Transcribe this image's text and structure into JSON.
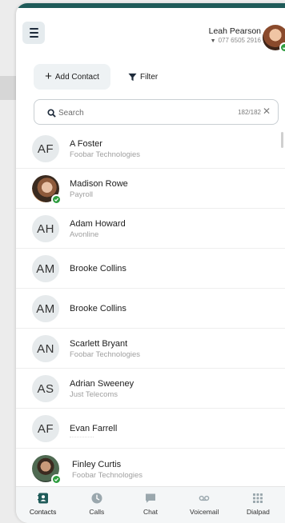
{
  "header": {
    "user_name": "Leah Pearson",
    "user_phone": "077 6505 2916",
    "status_color": "#2e9d3f"
  },
  "toolbar": {
    "add_contact_label": "Add Contact",
    "filter_label": "Filter"
  },
  "search": {
    "placeholder": "Search",
    "count": "182/182"
  },
  "contacts": [
    {
      "initials": "AF",
      "name": "A Foster",
      "company": "Foobar Technologies"
    },
    {
      "initials": "",
      "name": "Madison Rowe",
      "company": "Payroll",
      "online": true
    },
    {
      "initials": "AH",
      "name": "Adam Howard",
      "company": "Avonline"
    },
    {
      "initials": "AM",
      "name": "Brooke Collins",
      "company": ""
    },
    {
      "initials": "AM",
      "name": "Brooke Collins",
      "company": ""
    },
    {
      "initials": "AN",
      "name": "Scarlett Bryant",
      "company": "Foobar Technologies"
    },
    {
      "initials": "AS",
      "name": "Adrian Sweeney",
      "company": "Just Telecoms"
    },
    {
      "initials": "AF",
      "name": "Evan Farrell",
      "company": ""
    },
    {
      "initials": "",
      "name": "Finley Curtis",
      "company": "Foobar Technologies",
      "online": true
    }
  ],
  "nav": {
    "items": [
      {
        "label": "Contacts",
        "icon": "contacts-icon",
        "active": true
      },
      {
        "label": "Calls",
        "icon": "clock-icon"
      },
      {
        "label": "Chat",
        "icon": "chat-icon"
      },
      {
        "label": "Voicemail",
        "icon": "voicemail-icon"
      },
      {
        "label": "Dialpad",
        "icon": "dialpad-icon"
      }
    ],
    "active_color": "#1f5b59",
    "inactive_color": "#9aa7ad"
  }
}
